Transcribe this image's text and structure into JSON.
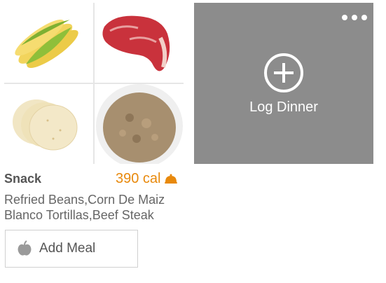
{
  "snack": {
    "meal_name": "Snack",
    "calories": "390 cal",
    "foods": "Refried Beans,Corn De Maiz Blanco Tortillas,Beef Steak",
    "photos": [
      "corn-icon",
      "beef-steak-icon",
      "tortillas-icon",
      "refried-beans-icon"
    ],
    "add_meal_label": "Add Meal",
    "accent_color": "#e8890c"
  },
  "dinner": {
    "log_label": "Log Dinner",
    "tile_color": "#8c8c8c"
  }
}
